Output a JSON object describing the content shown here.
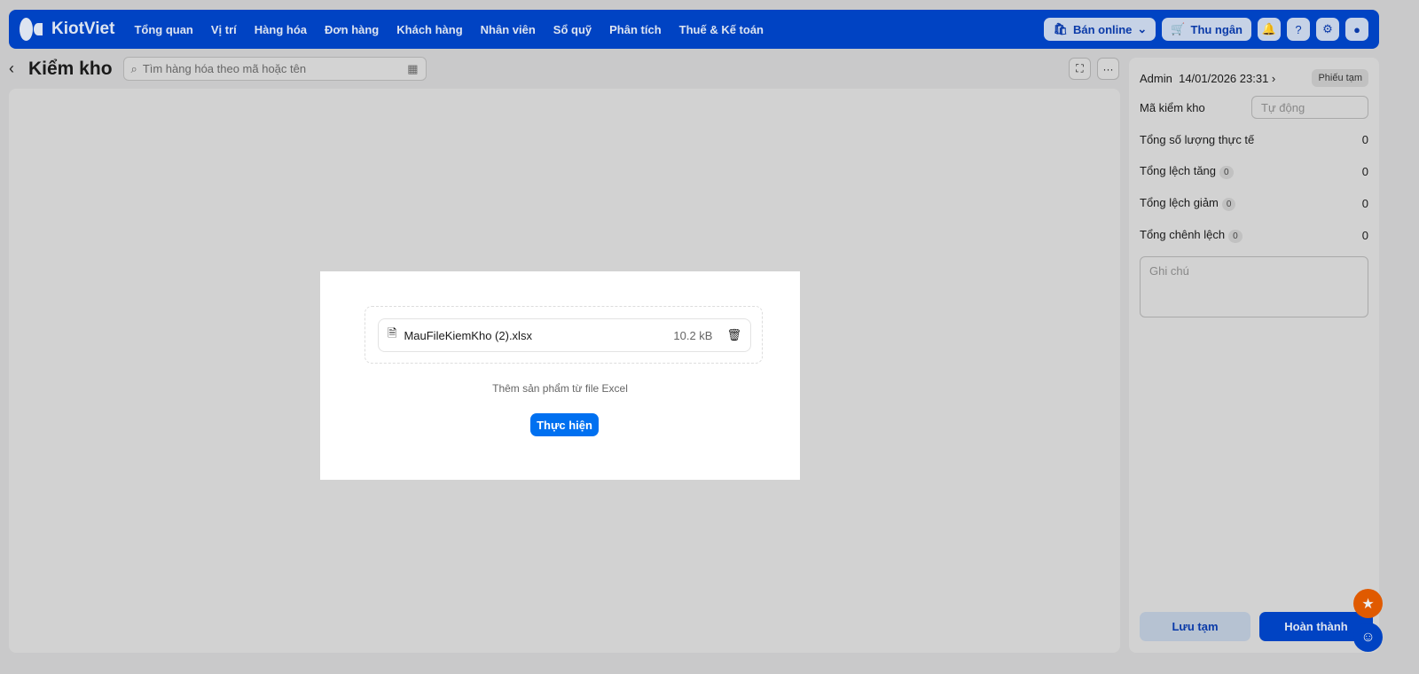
{
  "brand": "KiotViet",
  "nav": [
    "Tổng quan",
    "Vị trí",
    "Hàng hóa",
    "Đơn hàng",
    "Khách hàng",
    "Nhân viên",
    "Sổ quỹ",
    "Phân tích",
    "Thuế & Kế toán"
  ],
  "top_actions": {
    "online": "Bán online",
    "cashier": "Thu ngân"
  },
  "page": {
    "title": "Kiểm kho",
    "search_placeholder": "Tìm hàng hóa theo mã hoặc tên"
  },
  "side": {
    "user": "Admin",
    "datetime": "14/01/2026 23:31",
    "status": "Phiếu tạm",
    "code_label": "Mã kiểm kho",
    "code_placeholder": "Tự động",
    "rows": [
      {
        "label": "Tổng số lượng thực tế",
        "value": "0"
      },
      {
        "label": "Tổng lệch tăng",
        "badge": "0",
        "value": "0"
      },
      {
        "label": "Tổng lệch giảm",
        "badge": "0",
        "value": "0"
      },
      {
        "label": "Tổng chênh lệch",
        "badge": "0",
        "value": "0"
      }
    ],
    "note_placeholder": "Ghi chú",
    "save": "Lưu tạm",
    "done": "Hoàn thành"
  },
  "modal": {
    "file_name": "MauFileKiemKho (2).xlsx",
    "file_size": "10.2 kB",
    "hint": "Thêm sản phẩm từ file Excel",
    "action": "Thực hiện"
  },
  "colors": {
    "primary": "#0043c3",
    "action": "#0070f0",
    "star": "#e05a00"
  }
}
